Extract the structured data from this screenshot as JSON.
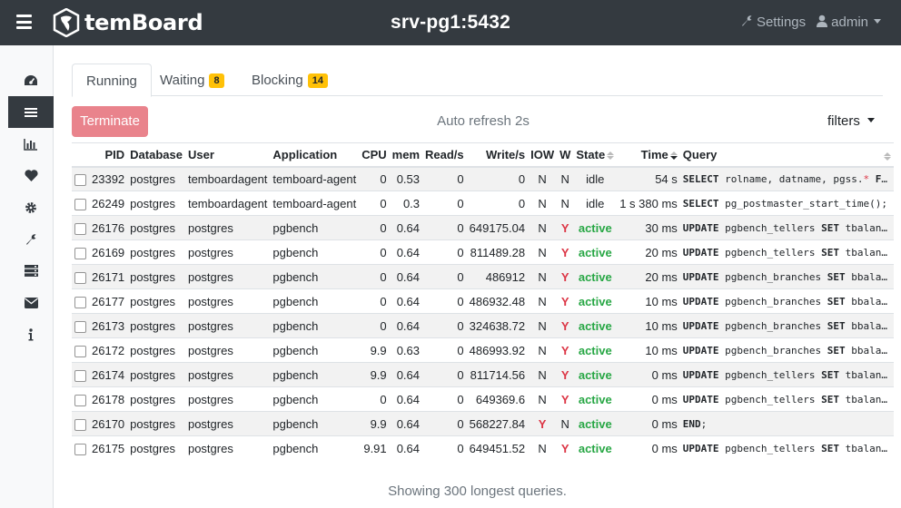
{
  "header": {
    "brand": "temBoard",
    "instance": "srv-pg1:5432",
    "settings_label": "Settings",
    "user_label": "admin"
  },
  "sidebar": {
    "items": [
      {
        "icon": "dashboard-icon",
        "active": false
      },
      {
        "icon": "list-icon",
        "active": true
      },
      {
        "icon": "bar-chart-icon",
        "active": false
      },
      {
        "icon": "heart-icon",
        "active": false
      },
      {
        "icon": "cog-icon",
        "active": false
      },
      {
        "icon": "wrench-icon",
        "active": false
      },
      {
        "icon": "server-icon",
        "active": false
      },
      {
        "icon": "envelope-icon",
        "active": false
      },
      {
        "icon": "info-icon",
        "active": false
      }
    ]
  },
  "tabs": [
    {
      "label": "Running",
      "badge": null,
      "active": true
    },
    {
      "label": "Waiting",
      "badge": "8",
      "active": false
    },
    {
      "label": "Blocking",
      "badge": "14",
      "active": false
    }
  ],
  "toolbar": {
    "terminate_label": "Terminate",
    "auto_refresh": "Auto refresh 2s",
    "filters_label": "filters"
  },
  "table": {
    "columns": [
      "PID",
      "Database",
      "User",
      "Application",
      "CPU",
      "mem",
      "Read/s",
      "Write/s",
      "IOW",
      "W",
      "State",
      "Time",
      "Query"
    ],
    "rows": [
      {
        "pid": "23392",
        "db": "postgres",
        "user": "temboardagent",
        "app": "temboard-agent",
        "cpu": "0",
        "mem": "0.53",
        "read": "0",
        "write": "0",
        "iow": "N",
        "w": "N",
        "state": "idle",
        "time": "54 s",
        "query_kw1": "SELECT",
        "query_rest": " rolname, datname, pgss.* FRO…"
      },
      {
        "pid": "26249",
        "db": "postgres",
        "user": "temboardagent",
        "app": "temboard-agent",
        "cpu": "0",
        "mem": "0.3",
        "read": "0",
        "write": "0",
        "iow": "N",
        "w": "N",
        "state": "idle",
        "time": "1 s 380 ms",
        "query_kw1": "SELECT",
        "query_rest": " pg_postmaster_start_time();"
      },
      {
        "pid": "26176",
        "db": "postgres",
        "user": "postgres",
        "app": "pgbench",
        "cpu": "0",
        "mem": "0.64",
        "read": "0",
        "write": "649175.04",
        "iow": "N",
        "w": "Y",
        "state": "active",
        "time": "30 ms",
        "query_kw1": "UPDATE",
        "query_mid": " pgbench_tellers ",
        "query_kw2": "SET",
        "query_rest": " tbalance…"
      },
      {
        "pid": "26169",
        "db": "postgres",
        "user": "postgres",
        "app": "pgbench",
        "cpu": "0",
        "mem": "0.64",
        "read": "0",
        "write": "811489.28",
        "iow": "N",
        "w": "Y",
        "state": "active",
        "time": "20 ms",
        "query_kw1": "UPDATE",
        "query_mid": " pgbench_tellers ",
        "query_kw2": "SET",
        "query_rest": " tbalance…"
      },
      {
        "pid": "26171",
        "db": "postgres",
        "user": "postgres",
        "app": "pgbench",
        "cpu": "0",
        "mem": "0.64",
        "read": "0",
        "write": "486912",
        "iow": "N",
        "w": "Y",
        "state": "active",
        "time": "20 ms",
        "query_kw1": "UPDATE",
        "query_mid": " pgbench_branches ",
        "query_kw2": "SET",
        "query_rest": " bbalanc…"
      },
      {
        "pid": "26177",
        "db": "postgres",
        "user": "postgres",
        "app": "pgbench",
        "cpu": "0",
        "mem": "0.64",
        "read": "0",
        "write": "486932.48",
        "iow": "N",
        "w": "Y",
        "state": "active",
        "time": "10 ms",
        "query_kw1": "UPDATE",
        "query_mid": " pgbench_branches ",
        "query_kw2": "SET",
        "query_rest": " bbalanc…"
      },
      {
        "pid": "26173",
        "db": "postgres",
        "user": "postgres",
        "app": "pgbench",
        "cpu": "0",
        "mem": "0.64",
        "read": "0",
        "write": "324638.72",
        "iow": "N",
        "w": "Y",
        "state": "active",
        "time": "10 ms",
        "query_kw1": "UPDATE",
        "query_mid": " pgbench_branches ",
        "query_kw2": "SET",
        "query_rest": " bbalanc…"
      },
      {
        "pid": "26172",
        "db": "postgres",
        "user": "postgres",
        "app": "pgbench",
        "cpu": "9.9",
        "mem": "0.63",
        "read": "0",
        "write": "486993.92",
        "iow": "N",
        "w": "Y",
        "state": "active",
        "time": "10 ms",
        "query_kw1": "UPDATE",
        "query_mid": " pgbench_branches ",
        "query_kw2": "SET",
        "query_rest": " bbalanc…"
      },
      {
        "pid": "26174",
        "db": "postgres",
        "user": "postgres",
        "app": "pgbench",
        "cpu": "9.9",
        "mem": "0.64",
        "read": "0",
        "write": "811714.56",
        "iow": "N",
        "w": "Y",
        "state": "active",
        "time": "0 ms",
        "query_kw1": "UPDATE",
        "query_mid": " pgbench_tellers ",
        "query_kw2": "SET",
        "query_rest": " tbalance…"
      },
      {
        "pid": "26178",
        "db": "postgres",
        "user": "postgres",
        "app": "pgbench",
        "cpu": "0",
        "mem": "0.64",
        "read": "0",
        "write": "649369.6",
        "iow": "N",
        "w": "Y",
        "state": "active",
        "time": "0 ms",
        "query_kw1": "UPDATE",
        "query_mid": " pgbench_tellers ",
        "query_kw2": "SET",
        "query_rest": " tbalance…"
      },
      {
        "pid": "26170",
        "db": "postgres",
        "user": "postgres",
        "app": "pgbench",
        "cpu": "9.9",
        "mem": "0.64",
        "read": "0",
        "write": "568227.84",
        "iow": "Y",
        "w": "N",
        "state": "active",
        "time": "0 ms",
        "query_kw1": "END",
        "query_rest": ";"
      },
      {
        "pid": "26175",
        "db": "postgres",
        "user": "postgres",
        "app": "pgbench",
        "cpu": "9.91",
        "mem": "0.64",
        "read": "0",
        "write": "649451.52",
        "iow": "N",
        "w": "Y",
        "state": "active",
        "time": "0 ms",
        "query_kw1": "UPDATE",
        "query_mid": " pgbench_tellers ",
        "query_kw2": "SET",
        "query_rest": " tbalance…"
      }
    ]
  },
  "footer": {
    "text": "Showing 300 longest queries."
  },
  "colors": {
    "topbar": "#343a40",
    "terminate": "#e9838c",
    "badge": "#ffc107",
    "active_state": "#28a745",
    "wait_yes": "#dc3545"
  }
}
